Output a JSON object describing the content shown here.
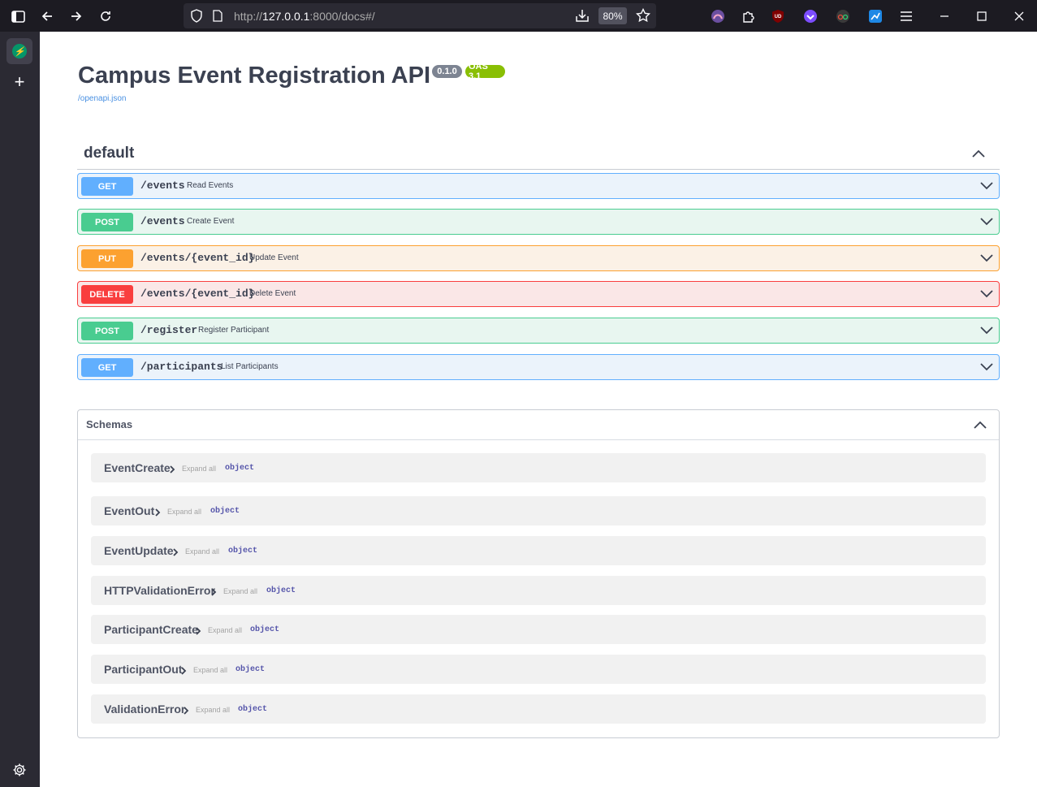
{
  "browser": {
    "url_prefix": "http://",
    "url_host": "127.0.0.1",
    "url_rest": ":8000/docs#/",
    "zoom": "80%"
  },
  "api": {
    "title": "Campus Event Registration API",
    "version": "0.1.0",
    "oas": "OAS 3.1",
    "openapi_link": "/openapi.json"
  },
  "section": {
    "name": "default"
  },
  "operations": [
    {
      "method": "GET",
      "path": "/events",
      "summary": "Read Events"
    },
    {
      "method": "POST",
      "path": "/events",
      "summary": "Create Event"
    },
    {
      "method": "PUT",
      "path": "/events/{event_id}",
      "summary": "Update Event"
    },
    {
      "method": "DELETE",
      "path": "/events/{event_id}",
      "summary": "Delete Event"
    },
    {
      "method": "POST",
      "path": "/register",
      "summary": "Register Participant"
    },
    {
      "method": "GET",
      "path": "/participants",
      "summary": "List Participants"
    }
  ],
  "schemas": {
    "label": "Schemas",
    "expand_label": "Expand all",
    "items": [
      {
        "name": "EventCreate",
        "type": "object"
      },
      {
        "name": "EventOut",
        "type": "object"
      },
      {
        "name": "EventUpdate",
        "type": "object"
      },
      {
        "name": "HTTPValidationError",
        "type": "object"
      },
      {
        "name": "ParticipantCreate",
        "type": "object"
      },
      {
        "name": "ParticipantOut",
        "type": "object"
      },
      {
        "name": "ValidationError",
        "type": "object"
      }
    ]
  }
}
